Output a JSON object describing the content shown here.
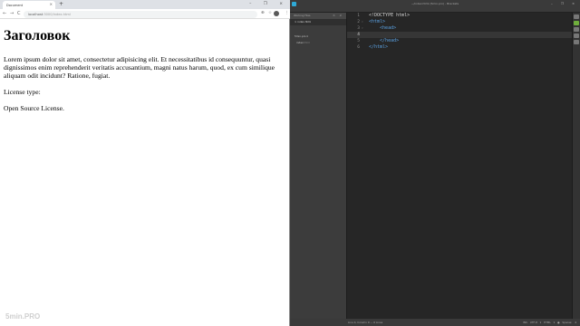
{
  "browser": {
    "tab_title": "Document",
    "tab_close": "×",
    "new_tab": "+",
    "window_controls": "– ❐ ×",
    "nav": {
      "back": "←",
      "forward": "→",
      "reload": "C"
    },
    "url_host": "localhost",
    "url_path": ":3000/index.html",
    "right_icons": {
      "zoom": "⊕",
      "star": "☆",
      "menu": "⋮"
    },
    "page": {
      "heading": "Заголовок",
      "paragraph": "Lorem ipsum dolor sit amet, consectetur adipisicing elit. Et necessitatibus id consequuntur, quasi dignissimos enim reprehenderit veritatis accusantium, magni natus harum, quod, ex cum similique aliquam odit incidunt? Ratione, fugiat.",
      "license_label": "License type:",
      "license_value": "Open Source License."
    },
    "watermark": "5min.PRO"
  },
  "editor": {
    "title": "~/index.html (5min.pro) - Brackets",
    "window_controls": "– ❐ ×",
    "menu": [
      "File",
      "Edit",
      "Find",
      "View",
      "Navigate",
      "Debug",
      "Help",
      "Emmet"
    ],
    "sidebar": {
      "working_files_label": "Working Files",
      "header_icons": "⚙ ⇵",
      "working_file": "× index.html",
      "project_label": "5min.pro ▾",
      "project_file": "index",
      "project_file_ext": ".html"
    },
    "code_lines": [
      {
        "num": "1",
        "fold": "",
        "parts": [
          {
            "cls": "tk-doc",
            "text": "<!DOCTYPE html>"
          }
        ]
      },
      {
        "num": "2",
        "fold": "▾",
        "parts": [
          {
            "cls": "tk-tag",
            "text": "<html>"
          }
        ]
      },
      {
        "num": "3",
        "fold": "▾",
        "parts": [
          {
            "cls": "tk-tag",
            "text": "    <head>"
          }
        ]
      },
      {
        "num": "4",
        "fold": "",
        "current": true,
        "parts": [
          {
            "cls": "tk-doc",
            "text": "        "
          }
        ]
      },
      {
        "num": "5",
        "fold": "",
        "parts": [
          {
            "cls": "tk-tag",
            "text": "    </head>"
          }
        ]
      },
      {
        "num": "6",
        "fold": "",
        "parts": [
          {
            "cls": "tk-tag",
            "text": "</html>"
          }
        ]
      }
    ],
    "status": {
      "left": "Line 4, Column 9 — 6 Lines",
      "right": "INS   UTF-8 ▾   HTML ▾   ●   Spaces: 4"
    }
  }
}
